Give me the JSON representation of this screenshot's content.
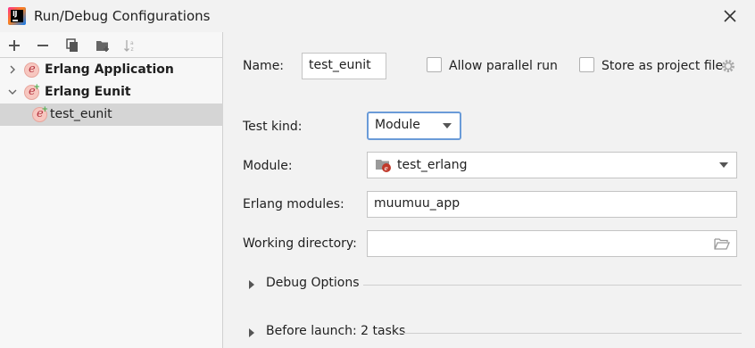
{
  "window": {
    "title": "Run/Debug Configurations",
    "app_icon": "intellij-idea-icon",
    "close_icon": "close-icon"
  },
  "toolbar": {
    "buttons": [
      {
        "icon": "add-icon"
      },
      {
        "icon": "remove-icon"
      },
      {
        "icon": "copy-icon"
      },
      {
        "icon": "new-folder-icon"
      },
      {
        "icon": "sort-alphabetically-icon"
      }
    ]
  },
  "tree": {
    "items": [
      {
        "label": "Erlang Application",
        "bold": true,
        "expanded": false,
        "icon": "erlang-icon"
      },
      {
        "label": "Erlang Eunit",
        "bold": true,
        "expanded": true,
        "icon": "erlang-eunit-icon"
      },
      {
        "label": "test_eunit",
        "bold": false,
        "selected": true,
        "icon": "erlang-eunit-icon"
      }
    ]
  },
  "form": {
    "name_label": "Name:",
    "name_value": "test_eunit",
    "allow_parallel_label": "Allow parallel run",
    "allow_parallel_checked": false,
    "store_project_label": "Store as project file",
    "store_project_checked": false,
    "test_kind_label": "Test kind:",
    "test_kind_value": "Module",
    "module_label": "Module:",
    "module_value": "test_erlang",
    "erlang_modules_label": "Erlang modules:",
    "erlang_modules_value": "muumuu_app",
    "working_dir_label": "Working directory:",
    "working_dir_value": ""
  },
  "sections": {
    "debug_options": "Debug Options",
    "before_launch": "Before launch: 2 tasks"
  },
  "colors": {
    "selection": "#d5d5d5",
    "focus_border": "#6a9bd8",
    "erlang_red": "#b4343f"
  }
}
